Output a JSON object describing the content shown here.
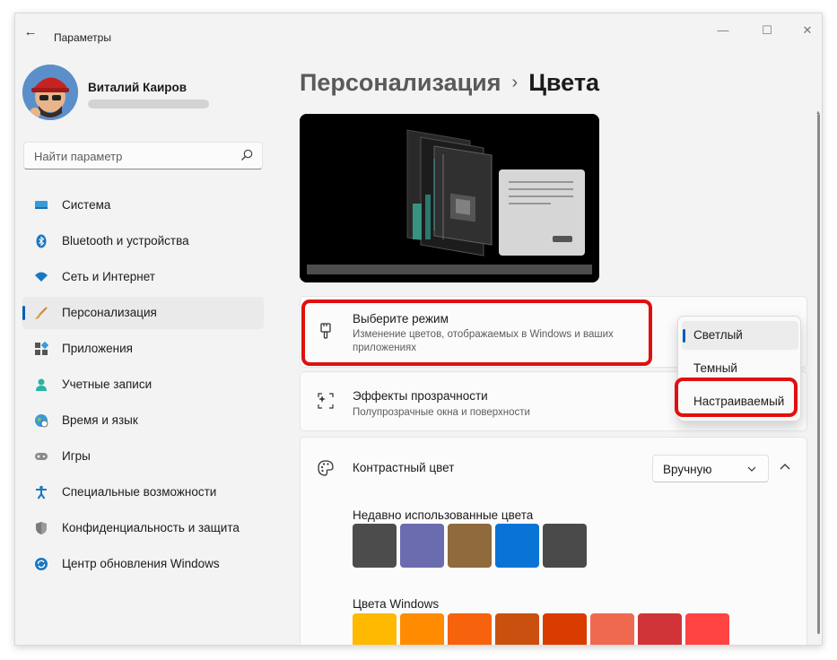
{
  "window": {
    "app_title": "Параметры",
    "minimize_glyph": "—",
    "maximize_glyph": "☐",
    "close_glyph": "✕",
    "back_glyph": "←"
  },
  "user": {
    "name": "Виталий Каиров"
  },
  "search": {
    "placeholder": "Найти параметр"
  },
  "nav": {
    "items": [
      {
        "label": "Система",
        "icon": "system-icon"
      },
      {
        "label": "Bluetooth и устройства",
        "icon": "bluetooth-icon"
      },
      {
        "label": "Сеть и Интернет",
        "icon": "wifi-icon"
      },
      {
        "label": "Персонализация",
        "icon": "brush-icon",
        "active": true
      },
      {
        "label": "Приложения",
        "icon": "apps-icon"
      },
      {
        "label": "Учетные записи",
        "icon": "account-icon"
      },
      {
        "label": "Время и язык",
        "icon": "globe-icon"
      },
      {
        "label": "Игры",
        "icon": "gamepad-icon"
      },
      {
        "label": "Специальные возможности",
        "icon": "accessibility-icon"
      },
      {
        "label": "Конфиденциальность и защита",
        "icon": "shield-icon"
      },
      {
        "label": "Центр обновления Windows",
        "icon": "update-icon"
      }
    ]
  },
  "breadcrumb": {
    "parent": "Персонализация",
    "separator": "›",
    "current": "Цвета"
  },
  "mode": {
    "title": "Выберите режим",
    "description": "Изменение цветов, отображаемых в Windows и ваших приложениях",
    "options": [
      "Светлый",
      "Темный",
      "Настраиваемый"
    ],
    "selected": "Светлый"
  },
  "transparency": {
    "title": "Эффекты прозрачности",
    "description": "Полупрозрачные окна и поверхности"
  },
  "accent": {
    "title": "Контрастный цвет",
    "select_value": "Вручную",
    "recent_label": "Недавно использованные цвета",
    "recent_colors": [
      "#4c4c4c",
      "#6b6bb0",
      "#8e6a3c",
      "#0a74d6",
      "#4a4a4a"
    ],
    "windows_label": "Цвета Windows",
    "windows_colors": [
      "#ffb900",
      "#ff8c00",
      "#f7630c",
      "#ca5010",
      "#da3b01",
      "#ef6950",
      "#d13438",
      "#ff4343"
    ]
  },
  "colors": {
    "accent": "#005fb8",
    "highlight": "#e01010"
  }
}
